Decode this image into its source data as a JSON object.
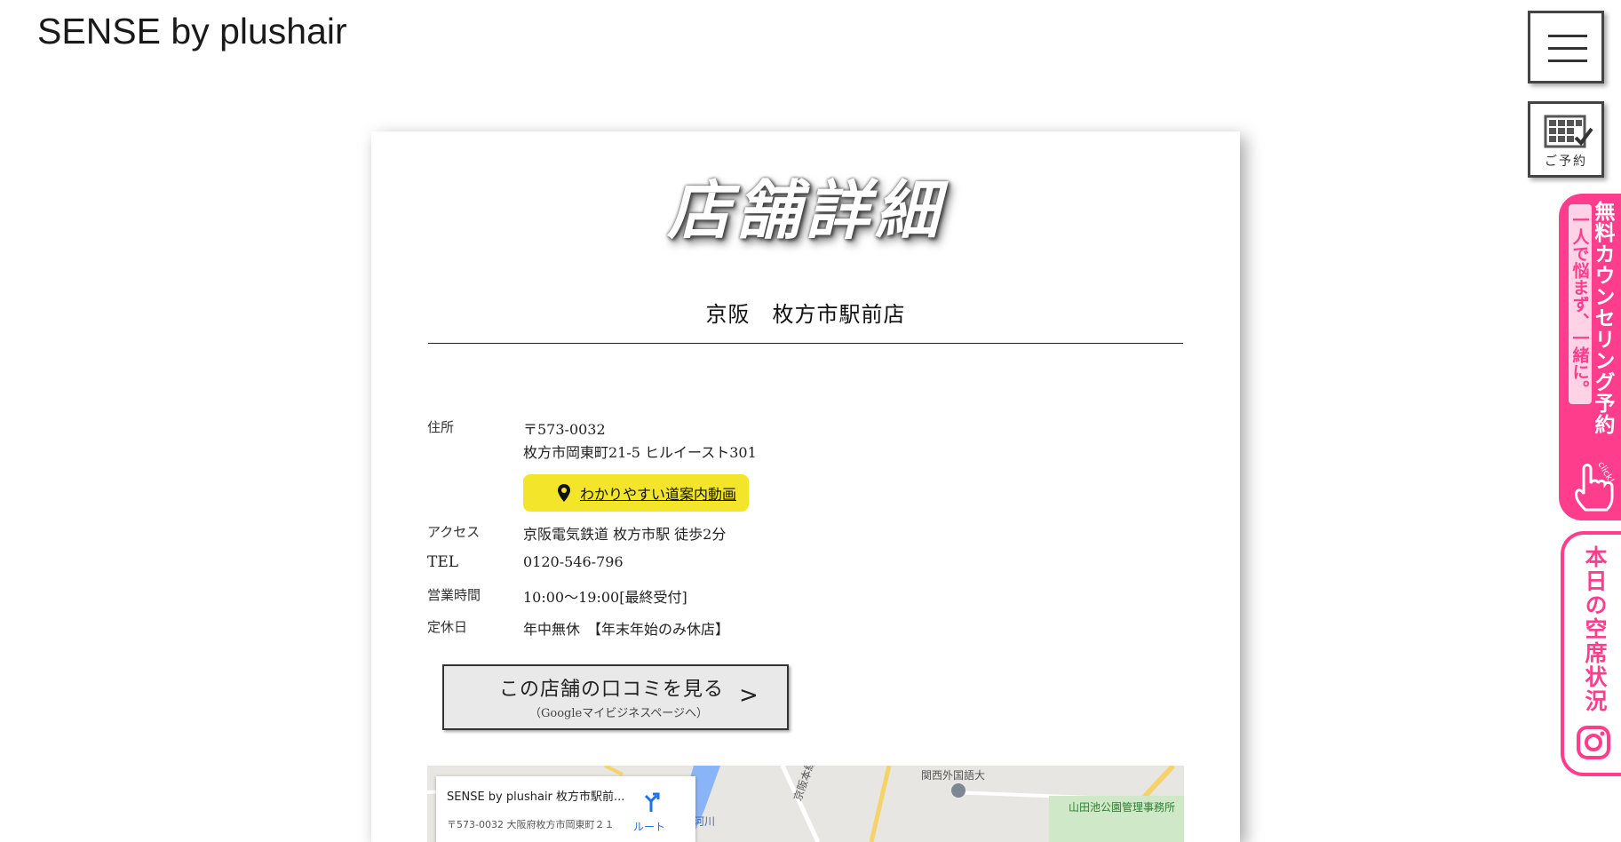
{
  "header": {
    "logo": "SENSE by plushair"
  },
  "side": {
    "reserve_label": "ご予約",
    "counseling_main": "無料カウンセリング予約",
    "counseling_sub": "一人で悩まず、一緒に。",
    "counseling_click": "click!",
    "vacancy_label": "本日の空席状況",
    "icons": [
      "hamburger-menu-icon",
      "calendar-check-icon",
      "pointing-hand-icon",
      "instagram-icon"
    ]
  },
  "page": {
    "title": "店舗詳細",
    "store_name": "京阪　枚方市駅前店",
    "address_label": "住所",
    "postal": "〒573-0032",
    "address": "枚方市岡東町21-5 ヒルイースト301",
    "guide_button": "わかりやすい道案内動画",
    "access_label": "アクセス",
    "access": "京阪電気鉄道 枚方市駅 徒歩2分",
    "tel_label": "TEL",
    "tel": "0120-546-796",
    "hours_label": "営業時間",
    "hours": "10:00〜19:00[最終受付]",
    "holiday_label": "定休日",
    "holiday": "年中無休　【年末年始のみ休店】",
    "review_button": "この店舗の口コミを見る",
    "review_sub": "（Googleマイビジネスページへ）",
    "review_arrow": ">"
  },
  "map": {
    "place_name": "SENSE by plushair 枚方市駅前...",
    "place_address": "〒573-0032 大阪府枚方市岡東町２１",
    "route_label": "ルート",
    "label_university": "関西外国語大",
    "label_park": "山田池公園管理事務所",
    "label_river": "河川",
    "label_line": "京阪本線"
  },
  "colors": {
    "accent_pink": "#ff3d8d",
    "guide_yellow": "#f3e62a"
  }
}
